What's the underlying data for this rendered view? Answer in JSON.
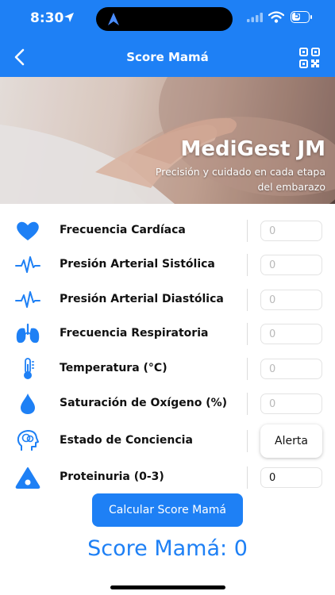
{
  "status_bar": {
    "time": "8:30",
    "battery": "50",
    "battery_level_percent": 50
  },
  "header": {
    "title": "Score Mamá",
    "back_icon": "chevron-left-icon",
    "qr_icon": "qr-code-icon",
    "color": "#1e80f5"
  },
  "hero": {
    "brand": "MediGest JM",
    "tagline": "Precisión y cuidado en cada etapa del embarazo"
  },
  "fields": [
    {
      "label": "Frecuencia Cardíaca",
      "icon": "heart-icon",
      "placeholder": "0",
      "value": ""
    },
    {
      "label": "Presión Arterial Sistólica",
      "icon": "pulse-line-icon",
      "placeholder": "0",
      "value": ""
    },
    {
      "label": "Presión Arterial Diastólica",
      "icon": "pulse-line-icon",
      "placeholder": "0",
      "value": ""
    },
    {
      "label": "Frecuencia Respiratoria",
      "icon": "lungs-icon",
      "placeholder": "0",
      "value": ""
    },
    {
      "label": "Temperatura (°C)",
      "icon": "thermometer-icon",
      "placeholder": "0",
      "value": ""
    },
    {
      "label": "Saturación de Oxígeno (%)",
      "icon": "drop-icon",
      "placeholder": "0",
      "value": ""
    },
    {
      "label": "Estado de Conciencia",
      "icon": "head-brain-icon",
      "selected": "Alerta"
    },
    {
      "label": "Proteinuria (0-3)",
      "icon": "triangle-drop-icon",
      "placeholder": "0",
      "value": "0"
    }
  ],
  "actions": {
    "calculate_label": "Calcular Score Mamá"
  },
  "result": {
    "text": "Score Mamá: 0"
  }
}
